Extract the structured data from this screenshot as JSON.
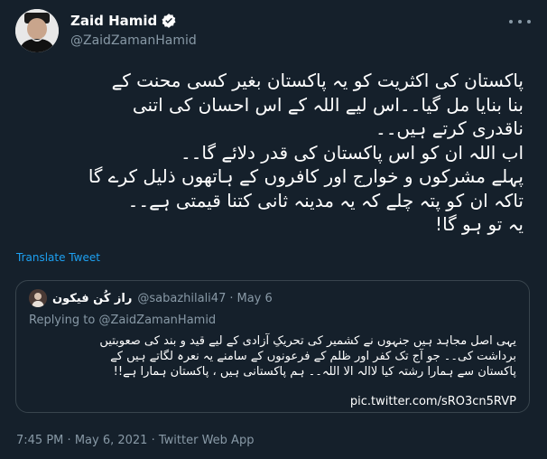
{
  "author": {
    "display_name": "Zaid Hamid",
    "handle": "@ZaidZamanHamid",
    "verified_icon": "verified-badge-icon"
  },
  "tweet": {
    "lines": [
      "پاکستان کی اکثریت کو یہ پاکستان بغیر کسی محنت کے",
      "بنا بنایا مل گیا۔۔اس لیے اللہ کے اس احسان کی اتنی",
      "ناقدری کرتے ہیں۔۔",
      "اب اللہ ان کو اس پاکستان کی قدر دلائے گا۔۔",
      "پہلے مشرکوں و خوارج اور کافروں کے ہاتھوں ذلیل کرے گا",
      "تاکہ ان کو پتہ چلے کہ یہ مدینہ ثانی کتنا قیمتی ہے۔۔",
      "یہ تو ہو گا!"
    ],
    "translate_label": "Translate Tweet"
  },
  "quoted": {
    "name": "راز کُن فیکون",
    "handle": "@sabazhilali47",
    "separator": "·",
    "date": "May 6",
    "replying_prefix": "Replying to ",
    "replying_handle": "@ZaidZamanHamid",
    "lines": [
      "یہی اصل مجاہد ہیں جنہوں نے کشمیر کی تحریکِ آزادی کے لیے قید و بند کی صعوبتیں",
      "برداشت کی۔۔ جو آج تک کفر اور ظلم کے فرعونوں کے سامنے یہ نعرہ لگاتے ہیں کے",
      "پاکستان سے ہمارا رشتہ کیا لاالہ الا اللہ۔۔ ہم پاکستانی ہیں ، پاکستان ہمارا ہے!!"
    ],
    "link": "pic.twitter.com/sRO3cn5RVP"
  },
  "meta": {
    "time": "7:45 PM",
    "separator": "·",
    "date": "May 6, 2021",
    "source": "Twitter Web App"
  },
  "colors": {
    "background": "#15202b",
    "link": "#1da1f2",
    "secondary": "#8899a6",
    "border": "#38444d"
  }
}
